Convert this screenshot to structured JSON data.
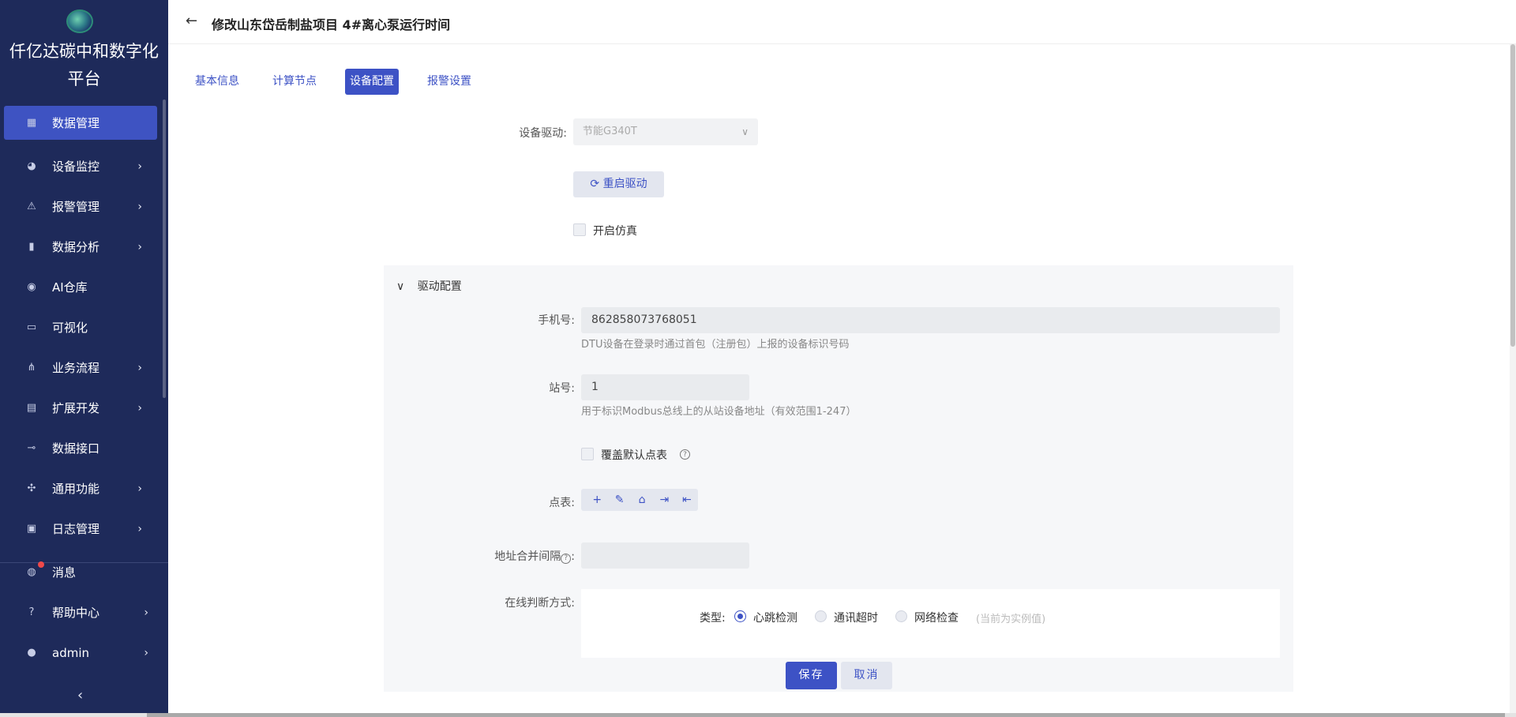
{
  "sidebar": {
    "brand": "仟亿达碳中和数字化平台",
    "items": [
      {
        "label": "数据管理",
        "icon": "chart-icon",
        "arrow": false
      },
      {
        "label": "设备监控",
        "icon": "monitor-icon",
        "arrow": true
      },
      {
        "label": "报警管理",
        "icon": "alarm-icon",
        "arrow": true
      },
      {
        "label": "数据分析",
        "icon": "bar-chart-icon",
        "arrow": true
      },
      {
        "label": "AI仓库",
        "icon": "ai-icon",
        "arrow": false
      },
      {
        "label": "可视化",
        "icon": "screen-icon",
        "arrow": false
      },
      {
        "label": "业务流程",
        "icon": "flow-icon",
        "arrow": true
      },
      {
        "label": "扩展开发",
        "icon": "code-icon",
        "arrow": true
      },
      {
        "label": "数据接口",
        "icon": "plug-icon",
        "arrow": false
      },
      {
        "label": "通用功能",
        "icon": "grid-icon",
        "arrow": true
      },
      {
        "label": "日志管理",
        "icon": "log-icon",
        "arrow": true
      }
    ],
    "bottom_items": [
      {
        "label": "消息",
        "icon": "message-icon"
      },
      {
        "label": "帮助中心",
        "icon": "help-icon"
      },
      {
        "label": "admin",
        "icon": "user-icon"
      }
    ]
  },
  "header": {
    "title": "修改山东岱岳制盐项目 4#离心泵运行时间"
  },
  "tabs": [
    "基本信息",
    "计算节点",
    "设备配置",
    "报警设置"
  ],
  "form": {
    "driver_label": "设备驱动:",
    "driver_value": "节能G340T",
    "restart_label": "重启驱动",
    "simulate_label": "开启仿真"
  },
  "panel": {
    "title": "驱动配置",
    "phone_label": "手机号:",
    "phone_value": "862858073768051",
    "phone_hint": "DTU设备在登录时通过首包（注册包）上报的设备标识号码",
    "station_label": "站号:",
    "station_value": "1",
    "station_hint": "用于标识Modbus总线上的从站设备地址（有效范围1-247）",
    "override_label": "覆盖默认点表",
    "points_label": "点表:",
    "merge_label": "地址合并间隔",
    "online_label": "在线判断方式:",
    "type_label": "类型:",
    "types": [
      "心跳检测",
      "通讯超时",
      "网络检查"
    ],
    "type_note": "(当前为实例值)"
  },
  "actions": {
    "save": "保存",
    "cancel": "取消"
  },
  "colors": {
    "sidebar_bg": "#1e2a5a",
    "accent": "#3d52c5"
  }
}
